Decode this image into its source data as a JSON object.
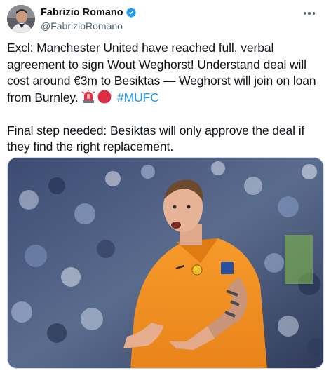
{
  "author": {
    "name": "Fabrizio Romano",
    "handle": "@FabrizioRomano",
    "avatar_icon": "profile-photo-avatar",
    "verified_icon": "verified-badge-icon",
    "verified_color": "#1d9bf0"
  },
  "menu": {
    "icon": "more-horizontal-icon"
  },
  "tweet": {
    "paragraph1_text": "Excl: Manchester United have reached full, verbal agreement to sign Wout Weghorst! Understand deal will cost around €3m to Besiktas — Weghorst will join on loan from Burnley.",
    "emoji_icons": [
      "rotating-light-icon",
      "red-circle-icon"
    ],
    "hashtag": "#MUFC",
    "paragraph2": "Final step needed: Besiktas will only approve the deal if they find the right replacement."
  },
  "media": {
    "type": "photo",
    "icon": "football-player-photo"
  },
  "colors": {
    "text": "#0f1419",
    "secondary": "#536471",
    "link": "#1d9bf0",
    "jersey": "#f7941d"
  }
}
